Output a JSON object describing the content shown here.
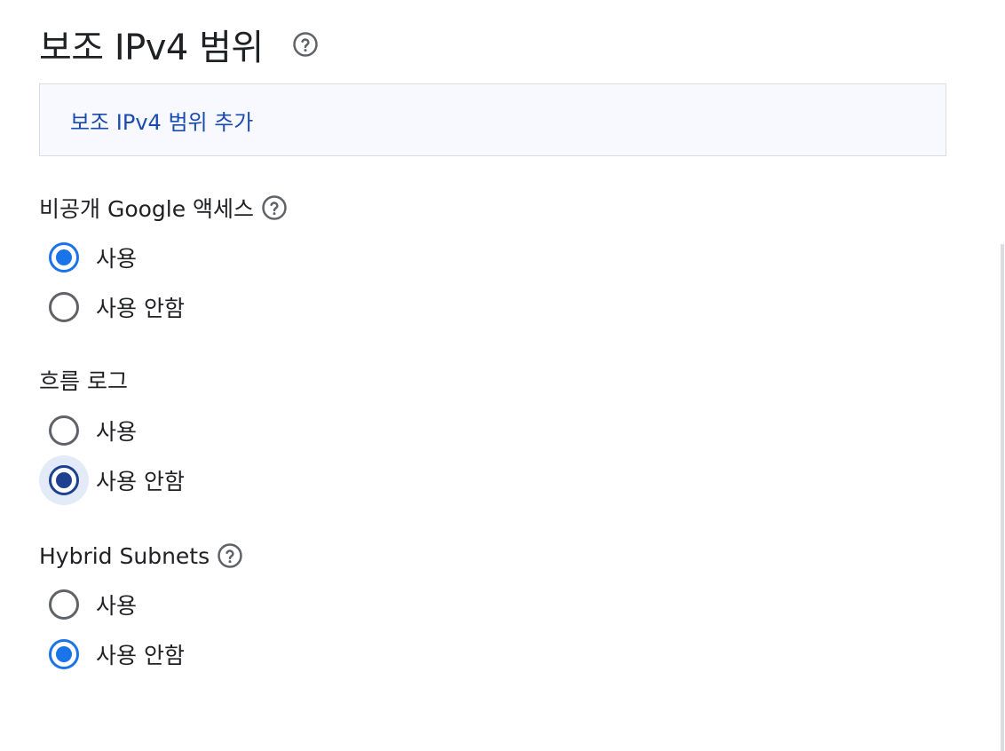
{
  "header": {
    "title": "보조 IPv4 범위",
    "help_icon": "help-circle-icon"
  },
  "add_range": {
    "label": "보조 IPv4 범위 추가"
  },
  "sections": [
    {
      "label": "비공개 Google 액세스",
      "has_help": true,
      "options": [
        {
          "label": "사용",
          "checked": true
        },
        {
          "label": "사용 안함",
          "checked": false
        }
      ]
    },
    {
      "label": "흐름 로그",
      "has_help": false,
      "options": [
        {
          "label": "사용",
          "checked": false
        },
        {
          "label": "사용 안함",
          "checked": true,
          "focused": true
        }
      ]
    },
    {
      "label": "Hybrid Subnets",
      "has_help": true,
      "options": [
        {
          "label": "사용",
          "checked": false
        },
        {
          "label": "사용 안함",
          "checked": true
        }
      ]
    }
  ],
  "colors": {
    "accent": "#1a73e8",
    "accent_focused": "#1f3f8f",
    "link": "#1a4bb0",
    "box_background": "#f8f9fe",
    "border": "#dadce0",
    "text": "#202124",
    "radio_unchecked": "#5f6368"
  }
}
